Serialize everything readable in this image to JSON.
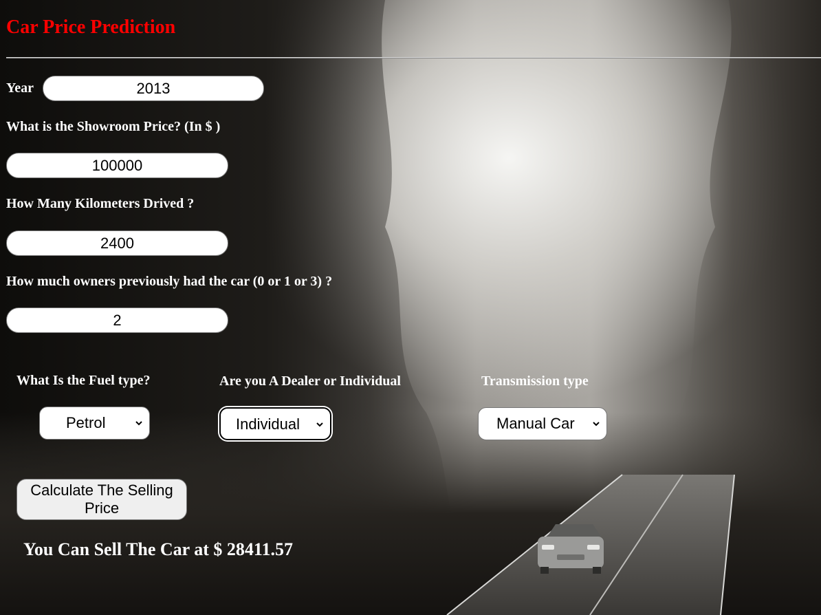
{
  "header": {
    "title": "Car Price Prediction",
    "title_color": "#ff0000"
  },
  "form": {
    "year": {
      "label": "Year",
      "value": "2013"
    },
    "showroom_price": {
      "label": "What is the Showroom Price? (In $ )",
      "value": "100000"
    },
    "kms_driven": {
      "label": "How Many Kilometers Drived ?",
      "value": "2400"
    },
    "owners": {
      "label": "How much owners previously had the car (0 or 1 or 3) ?",
      "value": "2"
    },
    "fuel_type": {
      "label": "What Is the Fuel type?",
      "selected": "Petrol",
      "icon": "chevron-down-icon"
    },
    "seller_type": {
      "label": "Are you A Dealer or Individual",
      "selected": "Individual",
      "icon": "chevron-down-icon"
    },
    "transmission": {
      "label": "Transmission type",
      "selected": "Manual Car",
      "icon": "chevron-down-icon"
    },
    "submit_label": "Calculate The Selling Price"
  },
  "result": {
    "text": "You Can Sell The Car at $ 28411.57"
  },
  "background": {
    "description_icon": "foggy-forest-road-car-image"
  }
}
